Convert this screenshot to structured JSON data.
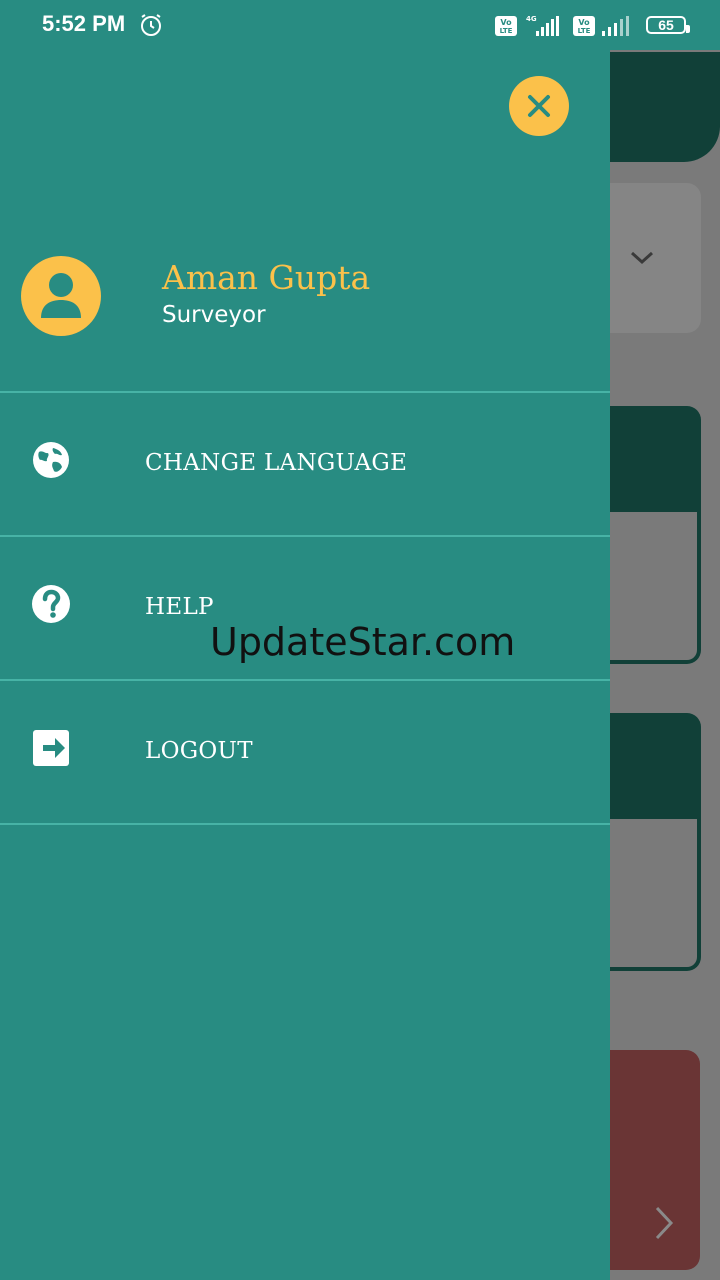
{
  "status_bar": {
    "time": "5:52 PM",
    "battery": "65",
    "icons": [
      "alarm-icon",
      "volte-icon",
      "signal-4g-icon",
      "volte-icon",
      "signal-icon",
      "battery-icon"
    ]
  },
  "drawer": {
    "user": {
      "name": "Aman Gupta",
      "role": "Surveyor"
    },
    "menu": [
      {
        "label": "CHANGE LANGUAGE",
        "icon": "globe-icon"
      },
      {
        "label": "HELP",
        "icon": "help-icon"
      },
      {
        "label": "LOGOUT",
        "icon": "logout-icon"
      }
    ]
  },
  "watermark": "UpdateStar.com",
  "colors": {
    "drawer_bg": "#288c82",
    "accent": "#fbc14a",
    "divider": "#47b3a6",
    "dark_teal": "#114038"
  }
}
